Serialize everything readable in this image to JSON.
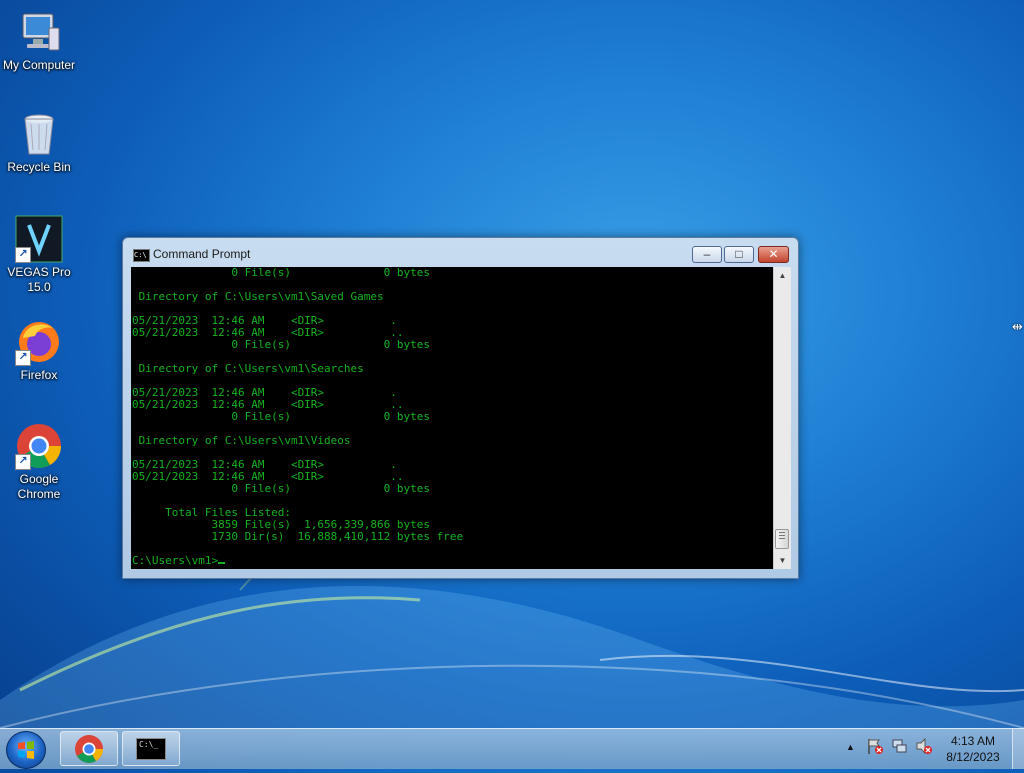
{
  "desktop": {
    "icons": [
      {
        "label": "My Computer"
      },
      {
        "label": "Recycle Bin"
      },
      {
        "label": "VEGAS Pro\n15.0"
      },
      {
        "label": "Firefox"
      },
      {
        "label": "Google\nChrome"
      }
    ]
  },
  "window": {
    "title": "Command Prompt",
    "title_icon_text": "C:\\",
    "minimize_glyph": "–",
    "maximize_glyph": "□",
    "close_glyph": "✕",
    "console_lines": [
      "               0 File(s)              0 bytes",
      "",
      " Directory of C:\\Users\\vm1\\Saved Games",
      "",
      "05/21/2023  12:46 AM    <DIR>          .",
      "05/21/2023  12:46 AM    <DIR>          ..",
      "               0 File(s)              0 bytes",
      "",
      " Directory of C:\\Users\\vm1\\Searches",
      "",
      "05/21/2023  12:46 AM    <DIR>          .",
      "05/21/2023  12:46 AM    <DIR>          ..",
      "               0 File(s)              0 bytes",
      "",
      " Directory of C:\\Users\\vm1\\Videos",
      "",
      "05/21/2023  12:46 AM    <DIR>          .",
      "05/21/2023  12:46 AM    <DIR>          ..",
      "               0 File(s)              0 bytes",
      "",
      "     Total Files Listed:",
      "            3859 File(s)  1,656,339,866 bytes",
      "            1730 Dir(s)  16,888,410,112 bytes free",
      "",
      "C:\\Users\\vm1>"
    ],
    "text_color": "#16b21e"
  },
  "taskbar": {
    "pinned": [
      {
        "name": "chrome"
      },
      {
        "name": "command-prompt",
        "text": "C:\\"
      }
    ],
    "clock": {
      "time": "4:13 AM",
      "date": "8/12/2023"
    }
  },
  "colors": {
    "desktop_blue": "#1f7fd4",
    "console_bg": "#000000",
    "console_text": "#16b21e"
  }
}
